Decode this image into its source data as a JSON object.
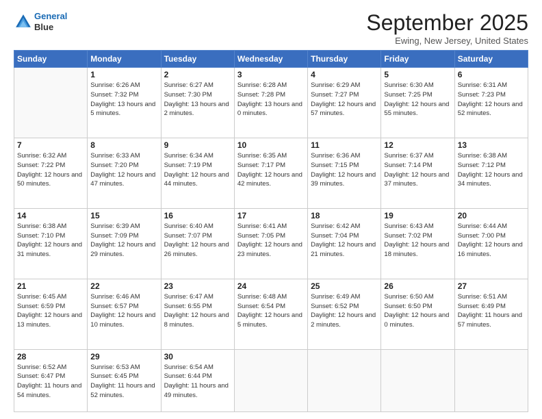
{
  "header": {
    "logo_line1": "General",
    "logo_line2": "Blue",
    "month_title": "September 2025",
    "location": "Ewing, New Jersey, United States"
  },
  "days_of_week": [
    "Sunday",
    "Monday",
    "Tuesday",
    "Wednesday",
    "Thursday",
    "Friday",
    "Saturday"
  ],
  "weeks": [
    [
      {
        "day": "",
        "sunrise": "",
        "sunset": "",
        "daylight": ""
      },
      {
        "day": "1",
        "sunrise": "Sunrise: 6:26 AM",
        "sunset": "Sunset: 7:32 PM",
        "daylight": "Daylight: 13 hours and 5 minutes."
      },
      {
        "day": "2",
        "sunrise": "Sunrise: 6:27 AM",
        "sunset": "Sunset: 7:30 PM",
        "daylight": "Daylight: 13 hours and 2 minutes."
      },
      {
        "day": "3",
        "sunrise": "Sunrise: 6:28 AM",
        "sunset": "Sunset: 7:28 PM",
        "daylight": "Daylight: 13 hours and 0 minutes."
      },
      {
        "day": "4",
        "sunrise": "Sunrise: 6:29 AM",
        "sunset": "Sunset: 7:27 PM",
        "daylight": "Daylight: 12 hours and 57 minutes."
      },
      {
        "day": "5",
        "sunrise": "Sunrise: 6:30 AM",
        "sunset": "Sunset: 7:25 PM",
        "daylight": "Daylight: 12 hours and 55 minutes."
      },
      {
        "day": "6",
        "sunrise": "Sunrise: 6:31 AM",
        "sunset": "Sunset: 7:23 PM",
        "daylight": "Daylight: 12 hours and 52 minutes."
      }
    ],
    [
      {
        "day": "7",
        "sunrise": "Sunrise: 6:32 AM",
        "sunset": "Sunset: 7:22 PM",
        "daylight": "Daylight: 12 hours and 50 minutes."
      },
      {
        "day": "8",
        "sunrise": "Sunrise: 6:33 AM",
        "sunset": "Sunset: 7:20 PM",
        "daylight": "Daylight: 12 hours and 47 minutes."
      },
      {
        "day": "9",
        "sunrise": "Sunrise: 6:34 AM",
        "sunset": "Sunset: 7:19 PM",
        "daylight": "Daylight: 12 hours and 44 minutes."
      },
      {
        "day": "10",
        "sunrise": "Sunrise: 6:35 AM",
        "sunset": "Sunset: 7:17 PM",
        "daylight": "Daylight: 12 hours and 42 minutes."
      },
      {
        "day": "11",
        "sunrise": "Sunrise: 6:36 AM",
        "sunset": "Sunset: 7:15 PM",
        "daylight": "Daylight: 12 hours and 39 minutes."
      },
      {
        "day": "12",
        "sunrise": "Sunrise: 6:37 AM",
        "sunset": "Sunset: 7:14 PM",
        "daylight": "Daylight: 12 hours and 37 minutes."
      },
      {
        "day": "13",
        "sunrise": "Sunrise: 6:38 AM",
        "sunset": "Sunset: 7:12 PM",
        "daylight": "Daylight: 12 hours and 34 minutes."
      }
    ],
    [
      {
        "day": "14",
        "sunrise": "Sunrise: 6:38 AM",
        "sunset": "Sunset: 7:10 PM",
        "daylight": "Daylight: 12 hours and 31 minutes."
      },
      {
        "day": "15",
        "sunrise": "Sunrise: 6:39 AM",
        "sunset": "Sunset: 7:09 PM",
        "daylight": "Daylight: 12 hours and 29 minutes."
      },
      {
        "day": "16",
        "sunrise": "Sunrise: 6:40 AM",
        "sunset": "Sunset: 7:07 PM",
        "daylight": "Daylight: 12 hours and 26 minutes."
      },
      {
        "day": "17",
        "sunrise": "Sunrise: 6:41 AM",
        "sunset": "Sunset: 7:05 PM",
        "daylight": "Daylight: 12 hours and 23 minutes."
      },
      {
        "day": "18",
        "sunrise": "Sunrise: 6:42 AM",
        "sunset": "Sunset: 7:04 PM",
        "daylight": "Daylight: 12 hours and 21 minutes."
      },
      {
        "day": "19",
        "sunrise": "Sunrise: 6:43 AM",
        "sunset": "Sunset: 7:02 PM",
        "daylight": "Daylight: 12 hours and 18 minutes."
      },
      {
        "day": "20",
        "sunrise": "Sunrise: 6:44 AM",
        "sunset": "Sunset: 7:00 PM",
        "daylight": "Daylight: 12 hours and 16 minutes."
      }
    ],
    [
      {
        "day": "21",
        "sunrise": "Sunrise: 6:45 AM",
        "sunset": "Sunset: 6:59 PM",
        "daylight": "Daylight: 12 hours and 13 minutes."
      },
      {
        "day": "22",
        "sunrise": "Sunrise: 6:46 AM",
        "sunset": "Sunset: 6:57 PM",
        "daylight": "Daylight: 12 hours and 10 minutes."
      },
      {
        "day": "23",
        "sunrise": "Sunrise: 6:47 AM",
        "sunset": "Sunset: 6:55 PM",
        "daylight": "Daylight: 12 hours and 8 minutes."
      },
      {
        "day": "24",
        "sunrise": "Sunrise: 6:48 AM",
        "sunset": "Sunset: 6:54 PM",
        "daylight": "Daylight: 12 hours and 5 minutes."
      },
      {
        "day": "25",
        "sunrise": "Sunrise: 6:49 AM",
        "sunset": "Sunset: 6:52 PM",
        "daylight": "Daylight: 12 hours and 2 minutes."
      },
      {
        "day": "26",
        "sunrise": "Sunrise: 6:50 AM",
        "sunset": "Sunset: 6:50 PM",
        "daylight": "Daylight: 12 hours and 0 minutes."
      },
      {
        "day": "27",
        "sunrise": "Sunrise: 6:51 AM",
        "sunset": "Sunset: 6:49 PM",
        "daylight": "Daylight: 11 hours and 57 minutes."
      }
    ],
    [
      {
        "day": "28",
        "sunrise": "Sunrise: 6:52 AM",
        "sunset": "Sunset: 6:47 PM",
        "daylight": "Daylight: 11 hours and 54 minutes."
      },
      {
        "day": "29",
        "sunrise": "Sunrise: 6:53 AM",
        "sunset": "Sunset: 6:45 PM",
        "daylight": "Daylight: 11 hours and 52 minutes."
      },
      {
        "day": "30",
        "sunrise": "Sunrise: 6:54 AM",
        "sunset": "Sunset: 6:44 PM",
        "daylight": "Daylight: 11 hours and 49 minutes."
      },
      {
        "day": "",
        "sunrise": "",
        "sunset": "",
        "daylight": ""
      },
      {
        "day": "",
        "sunrise": "",
        "sunset": "",
        "daylight": ""
      },
      {
        "day": "",
        "sunrise": "",
        "sunset": "",
        "daylight": ""
      },
      {
        "day": "",
        "sunrise": "",
        "sunset": "",
        "daylight": ""
      }
    ]
  ]
}
